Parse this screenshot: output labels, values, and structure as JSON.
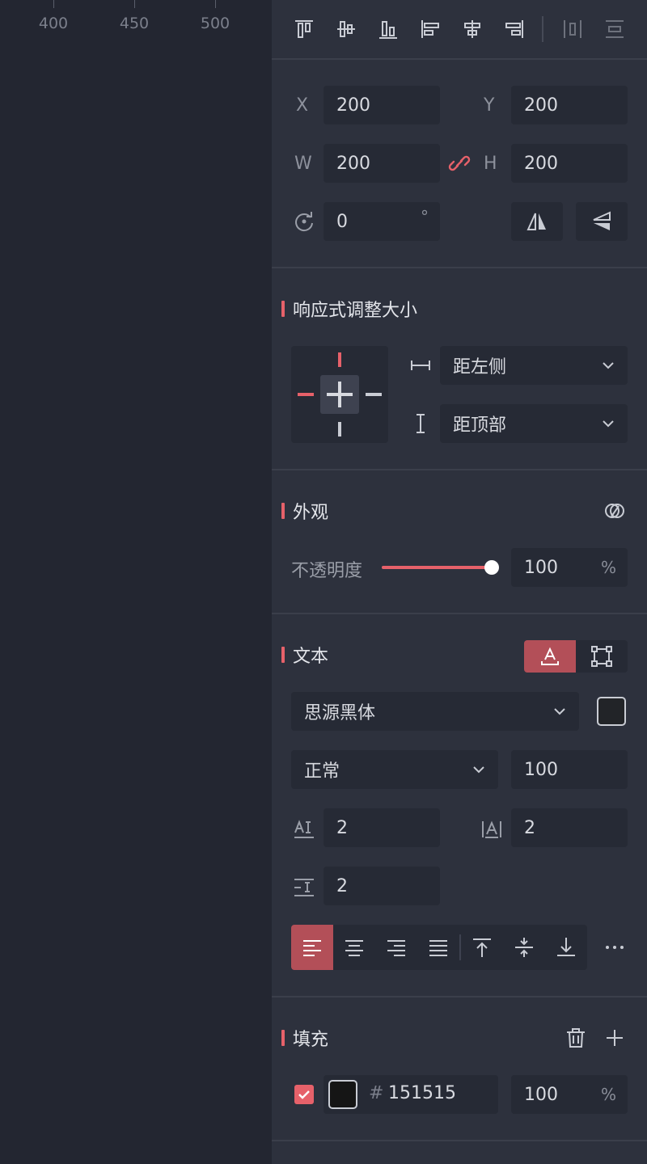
{
  "ruler": {
    "labels": [
      "400",
      "450",
      "500"
    ]
  },
  "transform": {
    "x_label": "X",
    "x_value": "200",
    "y_label": "Y",
    "y_value": "200",
    "w_label": "W",
    "w_value": "200",
    "h_label": "H",
    "h_value": "200",
    "rotation_value": "0",
    "rotation_unit": "°"
  },
  "responsive": {
    "title": "响应式调整大小",
    "horizontal": "距左侧",
    "vertical": "距顶部"
  },
  "appearance": {
    "title": "外观",
    "opacity_label": "不透明度",
    "opacity_value": "100",
    "opacity_unit": "%",
    "opacity_fraction": 1.0
  },
  "text": {
    "title": "文本",
    "font_family": "思源黑体",
    "font_weight": "正常",
    "font_size": "100",
    "letter_spacing": "2",
    "char_spacing": "2",
    "line_height": "2"
  },
  "fill": {
    "title": "填充",
    "hex_prefix": "#",
    "hex": "151515",
    "opacity": "100",
    "opacity_unit": "%",
    "color": "#151515"
  },
  "colors": {
    "accent": "#e6616a",
    "accent_dark": "#b34f58"
  }
}
